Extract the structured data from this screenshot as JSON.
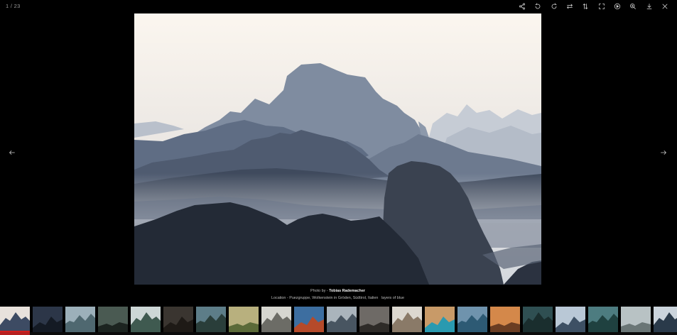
{
  "viewer": {
    "counter": "1 / 23",
    "toolbar": [
      {
        "name": "share-icon",
        "label": "Share"
      },
      {
        "name": "rotate-left-icon",
        "label": "Rotate left"
      },
      {
        "name": "rotate-right-icon",
        "label": "Rotate right"
      },
      {
        "name": "flip-horizontal-icon",
        "label": "Flip horizontal"
      },
      {
        "name": "flip-vertical-icon",
        "label": "Flip vertical"
      },
      {
        "name": "fullscreen-icon",
        "label": "Fullscreen"
      },
      {
        "name": "play-icon",
        "label": "Slideshow"
      },
      {
        "name": "zoom-in-icon",
        "label": "Zoom in"
      },
      {
        "name": "download-icon",
        "label": "Download"
      },
      {
        "name": "close-icon",
        "label": "Close"
      }
    ],
    "nav": {
      "prev_icon": "arrow-left-icon",
      "next_icon": "arrow-right-icon"
    }
  },
  "caption": {
    "photo_by_prefix": "Photo by - ",
    "photographer": "Tobias Rademacher",
    "location_line": "Location - Puezgruppe, Wolkenstein in Gröden, Südtirol, Italien",
    "tag": "layers of blue"
  },
  "thumbnails": [
    {
      "alt": "misty mountain layers",
      "sky": "#e8e2dc",
      "land": "#3d4b63"
    },
    {
      "alt": "dark mountain peaks",
      "sky": "#2c3648",
      "land": "#141a24"
    },
    {
      "alt": "foggy valley",
      "sky": "#9cb0ba",
      "land": "#4f6870"
    },
    {
      "alt": "forest road",
      "sky": "#4a5a52",
      "land": "#1c2420"
    },
    {
      "alt": "misty pine forest",
      "sky": "#cdd7d6",
      "land": "#3f5a50"
    },
    {
      "alt": "mushroom",
      "sky": "#3a3530",
      "land": "#1e1a16"
    },
    {
      "alt": "lake reflection",
      "sky": "#5d7d88",
      "land": "#2a3e3a"
    },
    {
      "alt": "golden meadow",
      "sky": "#b8b07e",
      "land": "#5b6a38"
    },
    {
      "alt": "lone tree",
      "sky": "#d6d6d0",
      "land": "#6c6c66"
    },
    {
      "alt": "autumn flowers",
      "sky": "#3d6ea0",
      "land": "#b54a2a"
    },
    {
      "alt": "cloudy hills",
      "sky": "#aab4bc",
      "land": "#485561"
    },
    {
      "alt": "rocky shore",
      "sky": "#6e6a66",
      "land": "#2e2b28"
    },
    {
      "alt": "snowy ridge",
      "sky": "#dcd8d0",
      "land": "#8a7a68"
    },
    {
      "alt": "turquoise lake",
      "sky": "#c89a68",
      "land": "#2a9ab0"
    },
    {
      "alt": "coastline",
      "sky": "#6f93ad",
      "land": "#2d5a74"
    },
    {
      "alt": "autumn mountain",
      "sky": "#d4884a",
      "land": "#6a3d22"
    },
    {
      "alt": "green peaks",
      "sky": "#2f4f52",
      "land": "#1a2e2e"
    },
    {
      "alt": "snowy peaks",
      "sky": "#b9c8d6",
      "land": "#3d5064"
    },
    {
      "alt": "teal lake",
      "sky": "#4d7c80",
      "land": "#1f4140"
    },
    {
      "alt": "misty lake",
      "sky": "#b8c2c4",
      "land": "#6a7676"
    },
    {
      "alt": "mountain skyline",
      "sky": "#cbd4dc",
      "land": "#2a3a4a"
    }
  ]
}
